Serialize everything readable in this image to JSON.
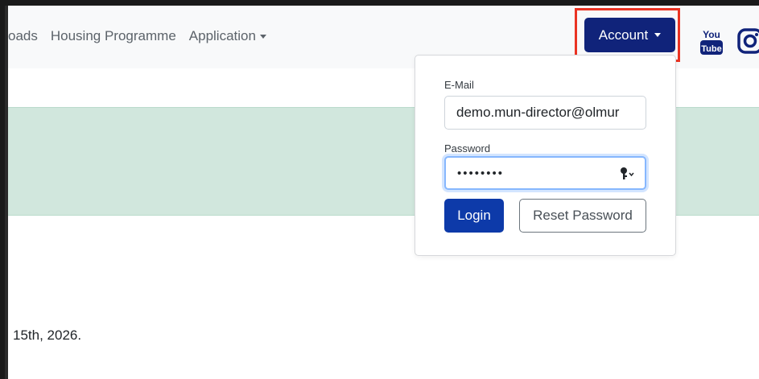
{
  "nav": {
    "links": [
      {
        "label": "oads"
      },
      {
        "label": "Housing Programme"
      },
      {
        "label": "Application"
      }
    ],
    "account_label": "Account",
    "social": {
      "youtube_top": "You",
      "youtube_bottom": "Tube"
    }
  },
  "login": {
    "email_label": "E-Mail",
    "email_value": "demo.mun-director@olmur",
    "password_label": "Password",
    "password_value": "••••••••",
    "login_label": "Login",
    "reset_label": "Reset Password"
  },
  "content": {
    "body_text": "15th, 2026."
  },
  "colors": {
    "account_bg": "#10237a",
    "highlight": "#ea3323",
    "banner": "#d1e7dd",
    "login_bg": "#0d3aa9"
  }
}
